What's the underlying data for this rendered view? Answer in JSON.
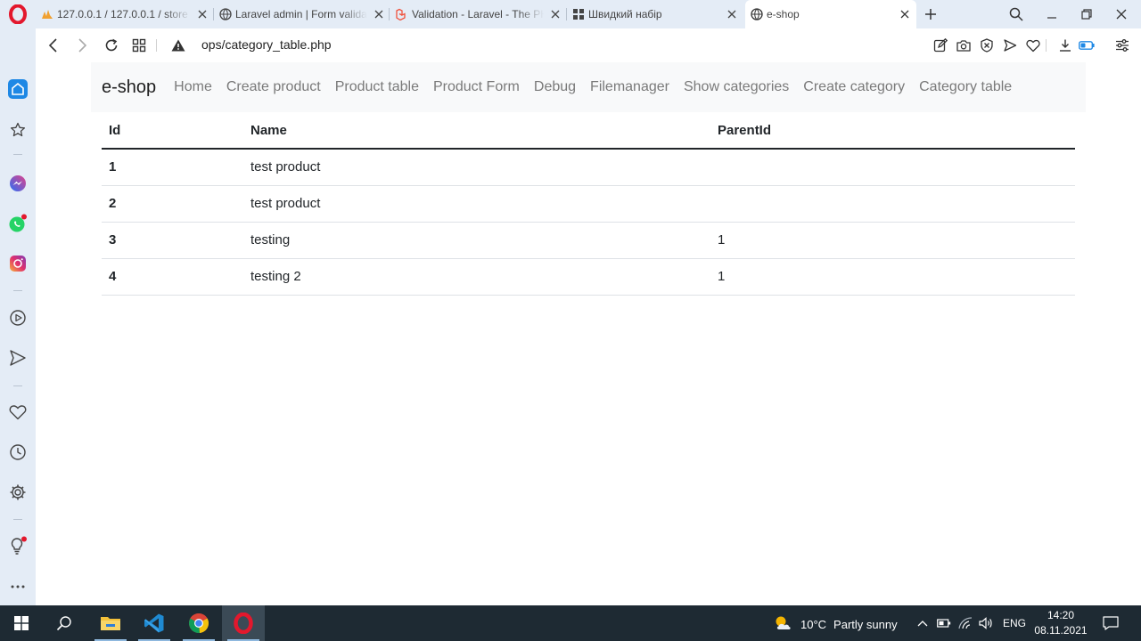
{
  "browser": {
    "tabs": [
      {
        "title": "127.0.0.1 / 127.0.0.1 / store",
        "favicon": "phpmyadmin-icon"
      },
      {
        "title": "Laravel admin | Form validation",
        "favicon": "globe-icon"
      },
      {
        "title": "Validation - Laravel - The PHP",
        "favicon": "laravel-icon"
      },
      {
        "title": "Швидкий набір",
        "favicon": "speed-dial-icon"
      },
      {
        "title": "e-shop",
        "favicon": "globe-icon",
        "active": true
      }
    ],
    "url": "ops/category_table.php"
  },
  "navbar": {
    "brand": "e-shop",
    "links": [
      "Home",
      "Create product",
      "Product table",
      "Product Form",
      "Debug",
      "Filemanager",
      "Show categories",
      "Create category",
      "Category table"
    ]
  },
  "table": {
    "headers": [
      "Id",
      "Name",
      "ParentId"
    ],
    "rows": [
      {
        "id": "1",
        "name": "test product",
        "parent_id": ""
      },
      {
        "id": "2",
        "name": "test product",
        "parent_id": ""
      },
      {
        "id": "3",
        "name": "testing",
        "parent_id": "1"
      },
      {
        "id": "4",
        "name": "testing 2",
        "parent_id": "1"
      }
    ]
  },
  "taskbar": {
    "weather": {
      "temp": "10°C",
      "desc": "Partly sunny"
    },
    "lang": "ENG",
    "time": "14:20",
    "date": "08.11.2021"
  },
  "colors": {
    "opera_red": "#e3182d",
    "sidebar_bg": "#e4ecf6",
    "navbar_bg": "#f8f9fa",
    "taskbar_bg": "#1e2a33",
    "accent_blue": "#1e88e5"
  }
}
